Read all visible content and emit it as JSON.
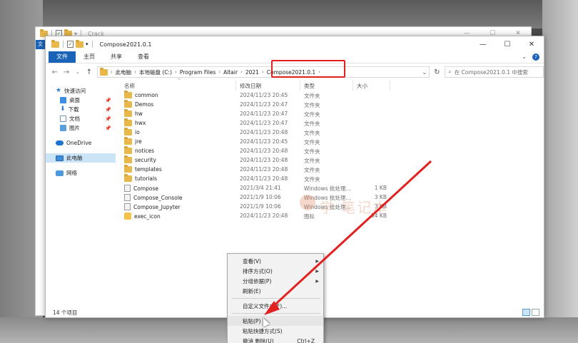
{
  "back_window": {
    "title": "Crack",
    "left_tab": "文",
    "controls": [
      "—",
      "☐",
      "✕"
    ]
  },
  "window": {
    "title": "Compose2021.0.1",
    "controls": [
      "—",
      "☐",
      "✕"
    ]
  },
  "ribbon": {
    "tabs": [
      "文件",
      "主页",
      "共享",
      "查看"
    ],
    "expand": "⌄",
    "help": "?"
  },
  "address": {
    "crumbs": [
      "此电脑",
      "本地磁盘 (C:)",
      "Program Files",
      "Altair",
      "2021",
      "Compose2021.0.1"
    ],
    "search_placeholder": "在 Compose2021.0.1 中搜索"
  },
  "nav": {
    "quick_access": "快速访问",
    "items": [
      "桌面",
      "下载",
      "文档",
      "图片"
    ],
    "onedrive": "OneDrive",
    "this_pc": "此电脑",
    "network": "网络"
  },
  "columns": {
    "name": "名称",
    "date": "修改日期",
    "type": "类型",
    "size": "大小"
  },
  "files": [
    {
      "name": "common",
      "date": "2024/11/23 20:45",
      "type": "文件夹",
      "size": "",
      "kind": "folder"
    },
    {
      "name": "Demos",
      "date": "2024/11/23 20:47",
      "type": "文件夹",
      "size": "",
      "kind": "folder"
    },
    {
      "name": "hw",
      "date": "2024/11/23 20:47",
      "type": "文件夹",
      "size": "",
      "kind": "folder"
    },
    {
      "name": "hwx",
      "date": "2024/11/23 20:47",
      "type": "文件夹",
      "size": "",
      "kind": "folder"
    },
    {
      "name": "io",
      "date": "2024/11/23 20:48",
      "type": "文件夹",
      "size": "",
      "kind": "folder"
    },
    {
      "name": "jre",
      "date": "2024/11/23 20:45",
      "type": "文件夹",
      "size": "",
      "kind": "folder"
    },
    {
      "name": "notices",
      "date": "2024/11/23 20:48",
      "type": "文件夹",
      "size": "",
      "kind": "folder"
    },
    {
      "name": "security",
      "date": "2024/11/23 20:48",
      "type": "文件夹",
      "size": "",
      "kind": "folder"
    },
    {
      "name": "templates",
      "date": "2024/11/23 20:48",
      "type": "文件夹",
      "size": "",
      "kind": "folder"
    },
    {
      "name": "tutorials",
      "date": "2024/11/23 20:48",
      "type": "文件夹",
      "size": "",
      "kind": "folder"
    },
    {
      "name": "Compose",
      "date": "2021/3/4 21:41",
      "type": "Windows 批处理...",
      "size": "1 KB",
      "kind": "file"
    },
    {
      "name": "Compose_Console",
      "date": "2021/1/9 10:06",
      "type": "Windows 批处理...",
      "size": "3 KB",
      "kind": "file"
    },
    {
      "name": "Compose_Jupyter",
      "date": "2021/1/9 10:06",
      "type": "Windows 批处理...",
      "size": "3 KB",
      "kind": "file"
    },
    {
      "name": "exec_icon",
      "date": "2024/11/23 20:48",
      "type": "图标",
      "size": "54 KB",
      "kind": "exec"
    }
  ],
  "status": {
    "count": "14 个项目"
  },
  "context_menu": {
    "items": [
      {
        "label": "查看(V)",
        "arrow": "▶",
        "shortcut": ""
      },
      {
        "label": "排序方式(O)",
        "arrow": "▶",
        "shortcut": ""
      },
      {
        "label": "分组依据(P)",
        "arrow": "▶",
        "shortcut": ""
      },
      {
        "label": "刷新(E)",
        "arrow": "",
        "shortcut": ""
      },
      {
        "sep": true
      },
      {
        "label": "自定义文件夹(F)...",
        "arrow": "",
        "shortcut": ""
      },
      {
        "sep": true
      },
      {
        "label": "粘贴(P)",
        "arrow": "",
        "shortcut": "",
        "highlight": true
      },
      {
        "label": "粘贴快捷方式(S)",
        "arrow": "",
        "shortcut": ""
      },
      {
        "label": "撤消 删除(U)",
        "arrow": "",
        "shortcut": "Ctrl+Z"
      }
    ]
  },
  "watermark": "学 笔记本",
  "colors": {
    "accent": "#1a63b8",
    "selection": "#cce4f7",
    "annotation_red": "#e32020",
    "folder": "#e8b84a"
  }
}
